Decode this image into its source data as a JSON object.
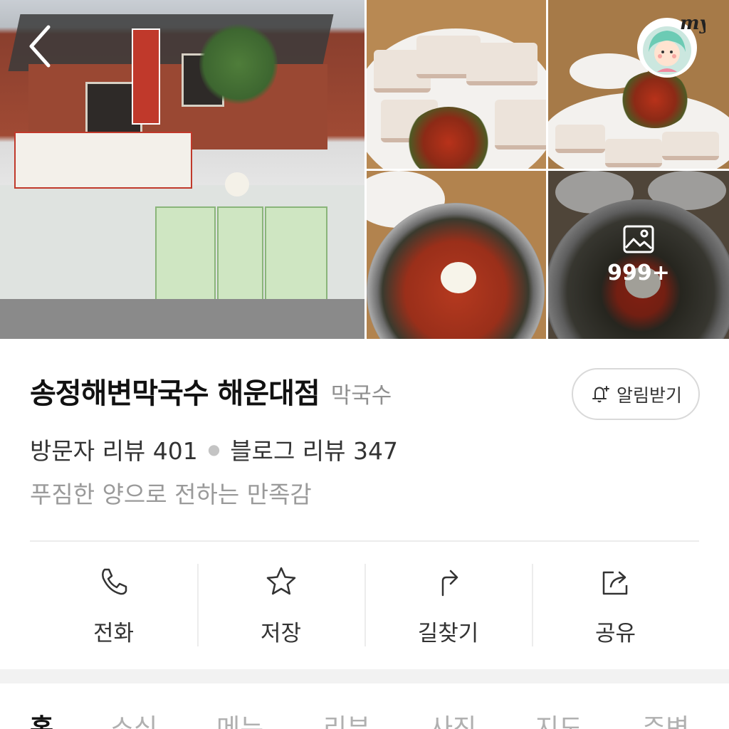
{
  "gallery": {
    "photo_count": "999+"
  },
  "place": {
    "name": "송정해변막국수 해운대점",
    "category": "막국수",
    "visitor_review_label": "방문자 리뷰 401",
    "blog_review_label": "블로그 리뷰 347",
    "description": "푸짐한 양으로 전하는 만족감"
  },
  "alarm": {
    "label": "알림받기"
  },
  "actions": [
    {
      "label": "전화",
      "icon": "phone-icon"
    },
    {
      "label": "저장",
      "icon": "star-icon"
    },
    {
      "label": "길찾기",
      "icon": "directions-icon"
    },
    {
      "label": "공유",
      "icon": "share-icon"
    }
  ],
  "tabs": [
    {
      "label": "홈",
      "active": true
    },
    {
      "label": "소식"
    },
    {
      "label": "메뉴"
    },
    {
      "label": "리뷰"
    },
    {
      "label": "사진"
    },
    {
      "label": "지도"
    },
    {
      "label": "주변"
    }
  ],
  "colors": {
    "text_primary": "#111111",
    "text_secondary": "#9a9a9a",
    "divider": "#ececec",
    "tab_inactive": "#b0b0b0"
  }
}
